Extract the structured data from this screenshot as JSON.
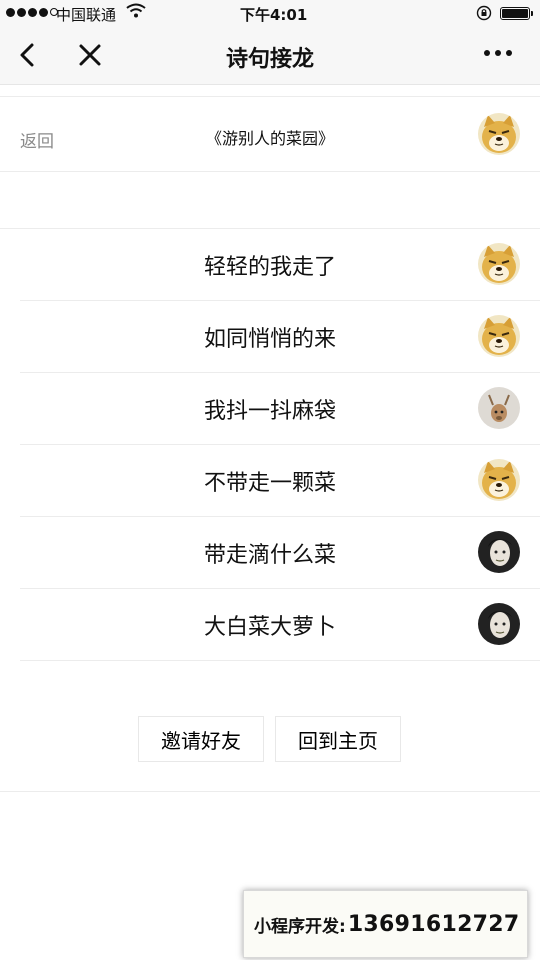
{
  "status_bar": {
    "carrier": "中国联通",
    "time": "下午4:01",
    "signal_bars_filled": 4,
    "signal_bars_total": 5
  },
  "nav": {
    "title": "诗句接龙",
    "back_icon": "chevron-left-icon",
    "close_icon": "close-icon",
    "more_icon": "more-dots-icon"
  },
  "header": {
    "back_label": "返回",
    "poem_title": "《游别人的菜园》",
    "avatar": "doge"
  },
  "verses": [
    {
      "text": "轻轻的我走了",
      "avatar": "doge"
    },
    {
      "text": "如同悄悄的来",
      "avatar": "doge"
    },
    {
      "text": "我抖一抖麻袋",
      "avatar": "deer"
    },
    {
      "text": "不带走一颗菜",
      "avatar": "doge"
    },
    {
      "text": "带走滴什么菜",
      "avatar": "man"
    },
    {
      "text": "大白菜大萝卜",
      "avatar": "man"
    }
  ],
  "actions": {
    "invite_label": "邀请好友",
    "home_label": "回到主页"
  },
  "banner": {
    "label": "小程序开发:",
    "phone": "13691612727"
  },
  "colors": {
    "nav_bg": "#f7f7f7",
    "divider": "#ececec",
    "muted_text": "#8a8a8a",
    "doge": "#e8b64a"
  }
}
